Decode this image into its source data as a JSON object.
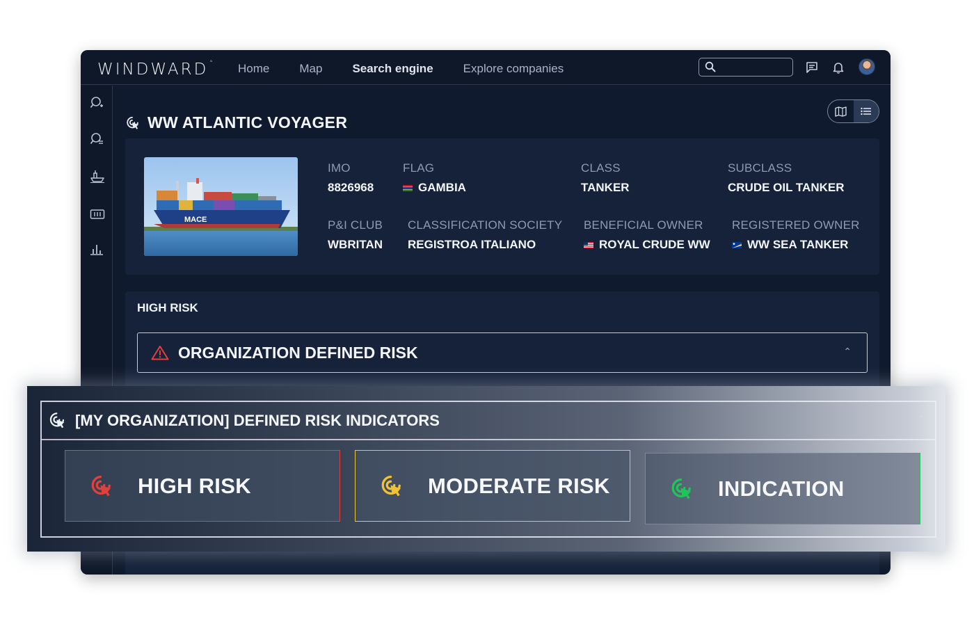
{
  "app": {
    "logo": "WINDWARD",
    "logo_mark": "°",
    "nav": [
      "Home",
      "Map",
      "Search engine",
      "Explore companies"
    ],
    "active_nav": "Search engine",
    "search": {
      "placeholder": ""
    }
  },
  "vessel": {
    "name": "WW ATLANTIC VOYAGER",
    "image_name": "ship-icon",
    "ship_hull_text": "MACE",
    "fields": {
      "imo": {
        "label": "IMO",
        "value": "8826968"
      },
      "flag": {
        "label": "FLAG",
        "value": "GAMBIA"
      },
      "class": {
        "label": "CLASS",
        "value": "TANKER"
      },
      "subclass": {
        "label": "SUBCLASS",
        "value": "CRUDE OIL TANKER"
      },
      "pi_club": {
        "label": "P&I CLUB",
        "value": "WBRITAN"
      },
      "classification_society": {
        "label": "CLASSIFICATION SOCIETY",
        "value": "REGISTROA ITALIANO"
      },
      "beneficial_owner": {
        "label": "BENEFICIAL OWNER",
        "value": "ROYAL CRUDE WW"
      },
      "registered_owner": {
        "label": "REGISTERED OWNER",
        "value": "WW SEA TANKER"
      }
    }
  },
  "risk": {
    "header": "HIGH RISK",
    "org_risk_title": "ORGANIZATION DEFINED RISK"
  },
  "indicators": {
    "title": "[MY ORGANIZATION] DEFINED RISK INDICATORS",
    "items": [
      {
        "label": "HIGH RISK",
        "color": "#e2413b"
      },
      {
        "label": "MODERATE RISK",
        "color": "#f1c232"
      },
      {
        "label": "INDICATION",
        "color": "#22c45a"
      }
    ]
  },
  "colors": {
    "background": "#101a2e",
    "card": "#16223a",
    "danger": "#e2413b",
    "warning": "#f1c232",
    "success": "#22c45a"
  }
}
